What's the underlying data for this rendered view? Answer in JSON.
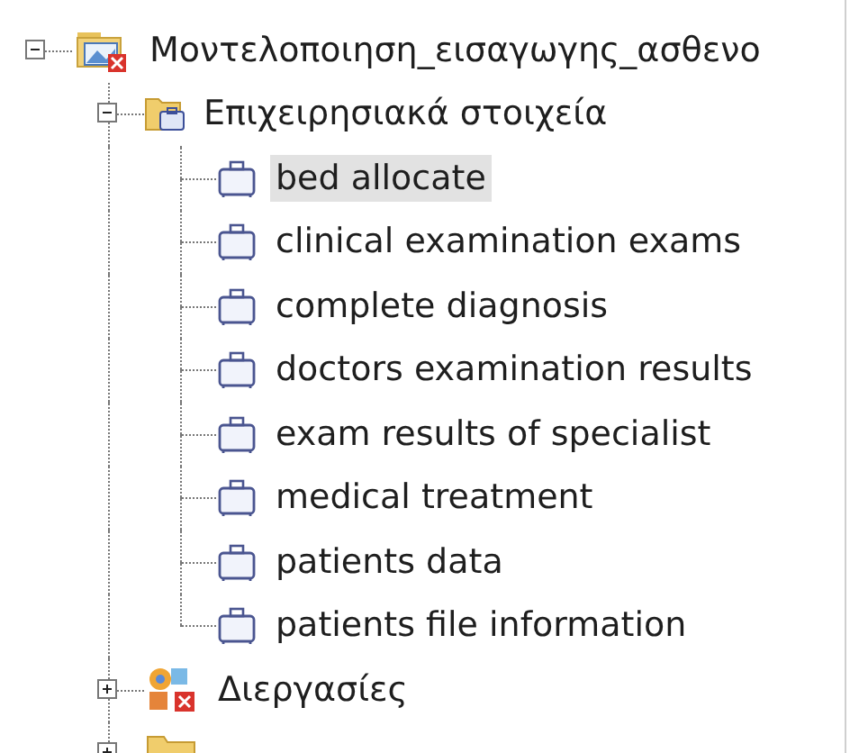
{
  "tree": [
    {
      "label": "Μοντελοποιηση_εισαγωγης_ασθενο",
      "kind": "model",
      "expanded": true,
      "selected": false,
      "children": [
        {
          "label": "Επιχειρησιακά στοιχεία",
          "kind": "category",
          "expanded": true,
          "selected": false,
          "children": [
            {
              "label": "bed allocate",
              "kind": "item",
              "selected": true
            },
            {
              "label": "clinical examination exams",
              "kind": "item",
              "selected": false
            },
            {
              "label": "complete diagnosis",
              "kind": "item",
              "selected": false
            },
            {
              "label": "doctors examination results",
              "kind": "item",
              "selected": false
            },
            {
              "label": "exam results of specialist",
              "kind": "item",
              "selected": false
            },
            {
              "label": "medical treatment",
              "kind": "item",
              "selected": false
            },
            {
              "label": "patients data",
              "kind": "item",
              "selected": false
            },
            {
              "label": "patients file information",
              "kind": "item",
              "selected": false
            }
          ]
        },
        {
          "label": "Διεργασίες",
          "kind": "process",
          "expanded": false,
          "selected": false
        },
        {
          "kind": "folder",
          "expanded": false
        }
      ]
    }
  ]
}
